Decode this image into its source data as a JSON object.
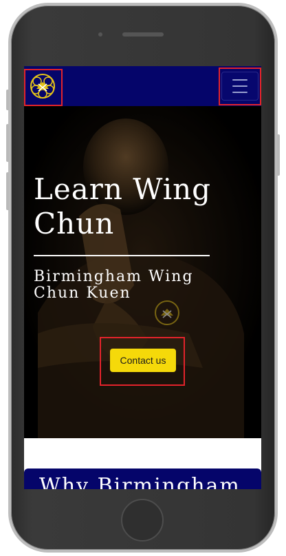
{
  "navbar": {
    "logo_icon": "wing-chun-emblem-icon",
    "menu_icon": "hamburger-menu-icon",
    "background": "#05056a"
  },
  "hero": {
    "title": "Learn Wing Chun",
    "subtitle": "Birmingham Wing Chun Kuen",
    "cta_label": "Contact us",
    "cta_color": "#f5d90a"
  },
  "section": {
    "title": "Why Birmingham"
  },
  "colors": {
    "accent_yellow": "#f5d90a",
    "navy": "#05056a",
    "highlight_red": "#e4232b"
  }
}
